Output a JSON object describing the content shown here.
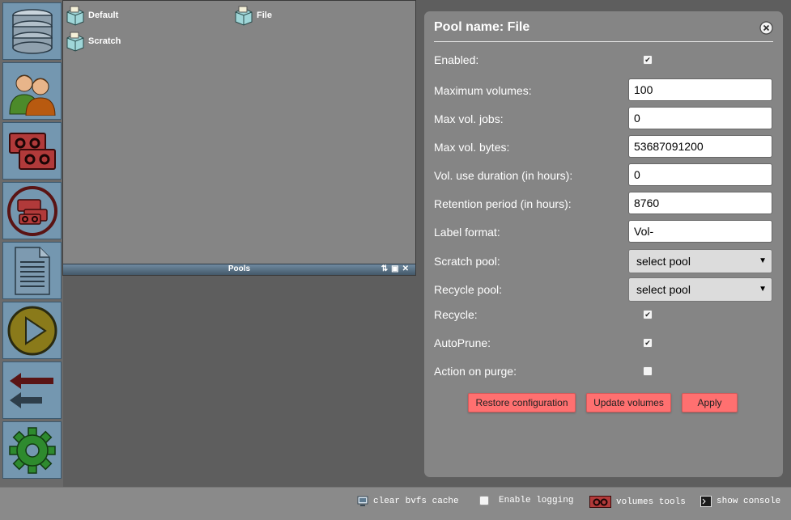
{
  "sidebar": {
    "buttons": [
      {
        "icon": "database-icon"
      },
      {
        "icon": "users-icon"
      },
      {
        "icon": "tapes-icon"
      },
      {
        "icon": "tape-circle-icon"
      },
      {
        "icon": "document-icon"
      },
      {
        "icon": "play-icon"
      },
      {
        "icon": "arrows-icon"
      },
      {
        "icon": "gear-icon"
      }
    ]
  },
  "pools": {
    "window_title": "Pools",
    "items": [
      {
        "label": "Default"
      },
      {
        "label": "File"
      },
      {
        "label": "Scratch"
      }
    ],
    "controls": {
      "swap": "⇅",
      "maximize": "▣",
      "close": "✕"
    }
  },
  "panel": {
    "title": "Pool name: File",
    "fields": {
      "enabled": {
        "label": "Enabled:",
        "checked": true
      },
      "max_volumes": {
        "label": "Maximum volumes:",
        "value": "100"
      },
      "max_vol_jobs": {
        "label": "Max vol. jobs:",
        "value": "0"
      },
      "max_vol_bytes": {
        "label": "Max vol. bytes:",
        "value": "53687091200"
      },
      "vol_use_duration": {
        "label": "Vol. use duration (in hours):",
        "value": "0"
      },
      "retention_period": {
        "label": "Retention period (in hours):",
        "value": "8760"
      },
      "label_format": {
        "label": "Label format:",
        "value": "Vol-"
      },
      "scratch_pool": {
        "label": "Scratch pool:",
        "selected": "select pool"
      },
      "recycle_pool": {
        "label": "Recycle pool:",
        "selected": "select pool"
      },
      "recycle": {
        "label": "Recycle:",
        "checked": true
      },
      "autoprune": {
        "label": "AutoPrune:",
        "checked": true
      },
      "action_on_purge": {
        "label": "Action on purge:",
        "checked": false
      }
    },
    "buttons": {
      "restore": "Restore configuration",
      "update_volumes": "Update volumes",
      "apply": "Apply"
    }
  },
  "bottombar": {
    "clear_bvfs": "clear bvfs cache",
    "enable_logging": "Enable logging",
    "volumes_tools": "volumes tools",
    "show_console": "show console"
  },
  "colors": {
    "accent_button": "#ff7070",
    "sidebar_button": "#7497b0",
    "panel_bg": "#858585"
  }
}
